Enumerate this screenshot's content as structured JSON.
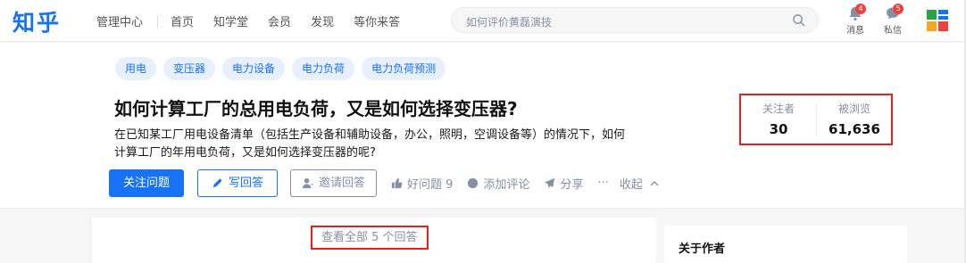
{
  "header": {
    "logo_text": "知乎",
    "nav": [
      "管理中心",
      "首页",
      "知学堂",
      "会员",
      "发现",
      "等你来答"
    ],
    "search_placeholder": "如何评价黄磊演技",
    "messages_label": "消息",
    "messages_count": "4",
    "dm_label": "私信",
    "dm_count": "5"
  },
  "question": {
    "tags": [
      "用电",
      "变压器",
      "电力设备",
      "电力负荷",
      "电力负荷预测"
    ],
    "title": "如何计算工厂的总用电负荷，又是如何选择变压器?",
    "description_line1": "在已知某工厂用电设备清单（包括生产设备和辅助设备，办公，照明，空调设备等）的情况下，如何",
    "description_line2": "计算工厂的年用电负荷，又是如何选择变压器的呢?",
    "follow_button": "关注问题",
    "write_answer_button": "写回答",
    "invite_button": "邀请回答",
    "good_question": "好问题 9",
    "add_comment": "添加评论",
    "share": "分享",
    "more": "···",
    "collapse": "收起"
  },
  "stats": {
    "followers_label": "关注者",
    "followers_value": "30",
    "views_label": "被浏览",
    "views_value": "61,636"
  },
  "answers": {
    "view_all": "查看全部 5 个回答"
  },
  "sidebar": {
    "about_author": "关于作者"
  },
  "colors": {
    "brand": "#1772f6",
    "highlight_border": "#e5201d",
    "badge": "#f1403c"
  }
}
